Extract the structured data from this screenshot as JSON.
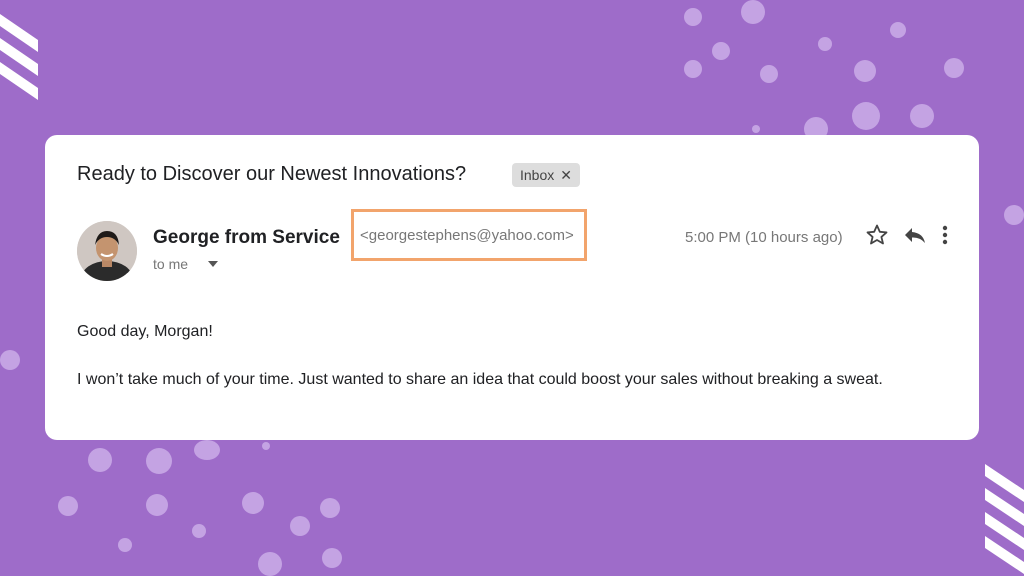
{
  "email": {
    "subject": "Ready to Discover our Newest Innovations?",
    "label_chip": "Inbox",
    "chip_close_glyph": "✕",
    "sender_name": "George from Service",
    "sender_email": "<georgestephens@yahoo.com>",
    "recipient": "to me",
    "timestamp": "5:00 PM (10 hours ago)",
    "body": {
      "greeting": "Good day, Morgan!",
      "paragraph": "I won’t take much of your time. Just wanted to share an idea that could boost your sales without breaking a sweat."
    }
  },
  "icons": {
    "star": "star-icon",
    "reply": "reply-icon",
    "more": "more-vertical-icon",
    "expand": "chevron-down-icon"
  },
  "colors": {
    "background": "#9e6cc9",
    "highlight_border": "#f2a46c",
    "card": "#ffffff"
  }
}
